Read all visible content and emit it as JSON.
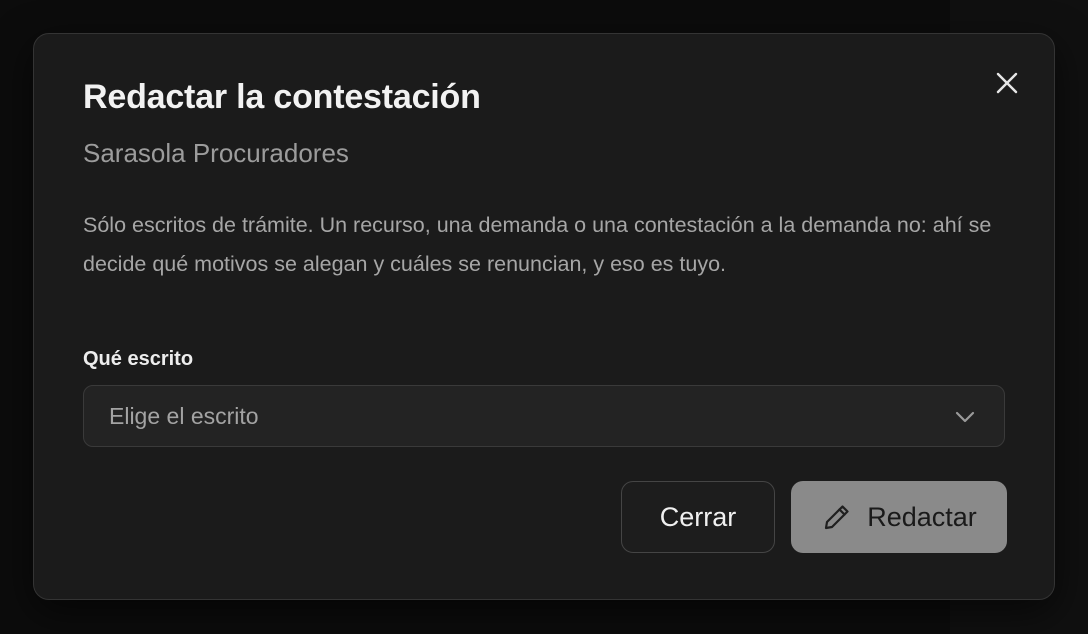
{
  "dialog": {
    "title": "Redactar la contestación",
    "subtitle": "Sarasola Procuradores",
    "description": "Sólo escritos de trámite. Un recurso, una demanda o una contestación a la demanda no: ahí se decide qué motivos se alegan y cuáles se renuncian, y eso es tuyo.",
    "field_label": "Qué escrito",
    "select_placeholder": "Elige el escrito",
    "close_label": "Cerrar",
    "primary_label": "Redactar",
    "close_icon": "close-icon",
    "chevron_icon": "chevron-down-icon",
    "primary_icon": "pencil-icon"
  },
  "colors": {
    "backdrop": "#0c0c0c",
    "modal_bg": "#1b1b1b",
    "modal_border": "#343434",
    "title": "#f2f2f2",
    "muted_text": "#a6a6a6",
    "primary_button_bg": "#8a8a8a",
    "primary_button_text": "#1a1a1a"
  }
}
